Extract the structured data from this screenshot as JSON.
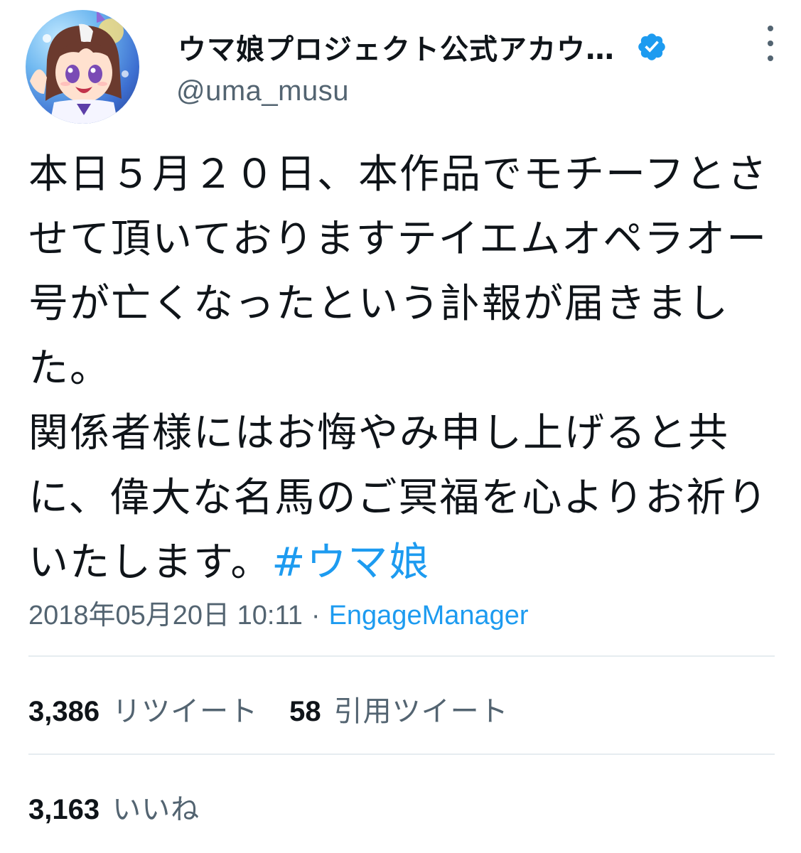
{
  "author": {
    "display_name": "ウマ娘プロジェクト公式アカウ…",
    "handle": "@uma_musu",
    "verified": true,
    "avatar_icon": "character-avatar",
    "verified_icon": "verified-badge-icon",
    "verified_color": "#1d9bf0"
  },
  "menu": {
    "icon": "more-vertical-icon"
  },
  "tweet": {
    "text": "本日５月２０日、本作品でモチーフとさせて頂いておりますテイエムオペラオー号が亡くなったという訃報が届きました。\n関係者様にはお悔やみ申し上げると共に、偉大な名馬のご冥福を心よりお祈りいたします。",
    "hashtag": "#ウマ娘",
    "timestamp": "2018年05月20日 10:11",
    "separator": "·",
    "source": "EngageManager"
  },
  "stats": {
    "retweets_count": "3,386",
    "retweets_label": "リツイート",
    "quotes_count": "58",
    "quotes_label": "引用ツイート",
    "likes_count": "3,163",
    "likes_label": "いいね"
  },
  "colors": {
    "accent": "#1d9bf0",
    "secondary_text": "#536471",
    "primary_text": "#0f1419",
    "divider": "#e6ecf0"
  }
}
